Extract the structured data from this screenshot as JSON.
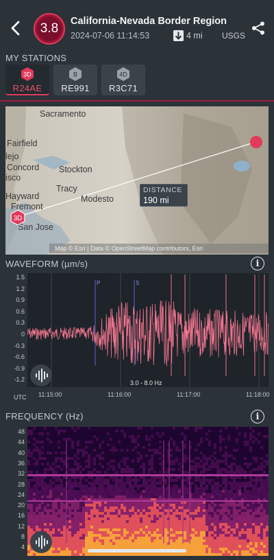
{
  "header": {
    "magnitude": "3.8",
    "title": "California-Nevada Border Region",
    "datetime": "2024-07-06 11:14:53",
    "distance": "4 mi",
    "source": "USGS"
  },
  "stations": {
    "label": "MY STATIONS",
    "items": [
      {
        "badge": "3D",
        "name": "R24AE",
        "active": true
      },
      {
        "badge": "B",
        "name": "RE991",
        "active": false
      },
      {
        "badge": "4D",
        "name": "R3C71",
        "active": false
      }
    ]
  },
  "map": {
    "places": [
      "Sacramento",
      "Fairfield",
      "Concord",
      "Stockton",
      "Tracy",
      "Modesto",
      "Hayward",
      "Fremont",
      "San Jose",
      "lejo",
      "isco"
    ],
    "distance_label": "DISTANCE",
    "distance_value": "190 mi",
    "station_badge": "3D",
    "attribution": "Map © Esri | Data © OpenStreetMap contributors, Esri"
  },
  "waveform": {
    "label": "WAVEFORM (µm/s)",
    "y_ticks": [
      "1.5",
      "1.2",
      "0.9",
      "0.6",
      "0.3",
      "0",
      "-0.3",
      "-0.6",
      "-0.9",
      "-1.2"
    ],
    "x_ticks": [
      "11:15:00",
      "11:16:00",
      "11:17:00",
      "11:18:00"
    ],
    "x_unit": "UTC",
    "filter": "3.0 - 8.0 Hz",
    "markers": [
      "P",
      "S"
    ]
  },
  "frequency": {
    "label": "FREQUENCY (Hz)",
    "y_ticks": [
      "48",
      "44",
      "40",
      "36",
      "32",
      "28",
      "24",
      "20",
      "16",
      "12",
      "8",
      "4"
    ]
  },
  "colors": {
    "accent": "#e23a5a",
    "wave": "#f0758f",
    "background": "#2b3238"
  }
}
